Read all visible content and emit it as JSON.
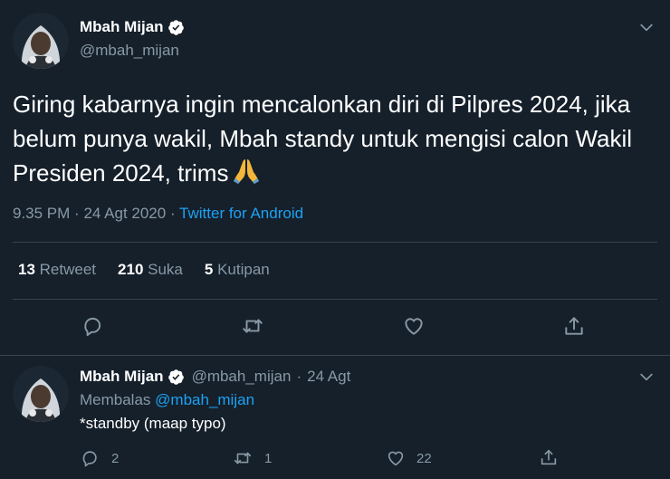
{
  "tweet": {
    "author": {
      "name": "Mbah Mijan",
      "handle": "@mbah_mijan"
    },
    "text": "Giring kabarnya ingin mencalonkan diri di Pilpres 2024, jika belum punya wakil, Mbah standy untuk mengisi calon Wakil Presiden 2024, trims",
    "emoji": "folded-hands",
    "time": "9.35 PM",
    "date": "24 Agt 2020",
    "separator": "·",
    "source": "Twitter for Android",
    "stats": {
      "retweets": {
        "count": "13",
        "label": "Retweet"
      },
      "likes": {
        "count": "210",
        "label": "Suka"
      },
      "quotes": {
        "count": "5",
        "label": "Kutipan"
      }
    }
  },
  "reply": {
    "author": {
      "name": "Mbah Mijan",
      "handle": "@mbah_mijan"
    },
    "separator": "·",
    "date": "24 Agt",
    "replying_prefix": "Membalas",
    "replying_to": "@mbah_mijan",
    "text": "*standby (maap typo)",
    "counts": {
      "replies": "2",
      "retweets": "1",
      "likes": "22"
    }
  },
  "colors": {
    "background": "#15202b",
    "text_primary": "#ffffff",
    "text_secondary": "#8899a6",
    "accent": "#1da1f2",
    "divider": "#38444d"
  },
  "icons": {
    "verified": "verified-badge-icon",
    "more": "chevron-down-icon",
    "reply": "reply-icon",
    "retweet": "retweet-icon",
    "like": "heart-icon",
    "share": "share-icon"
  }
}
